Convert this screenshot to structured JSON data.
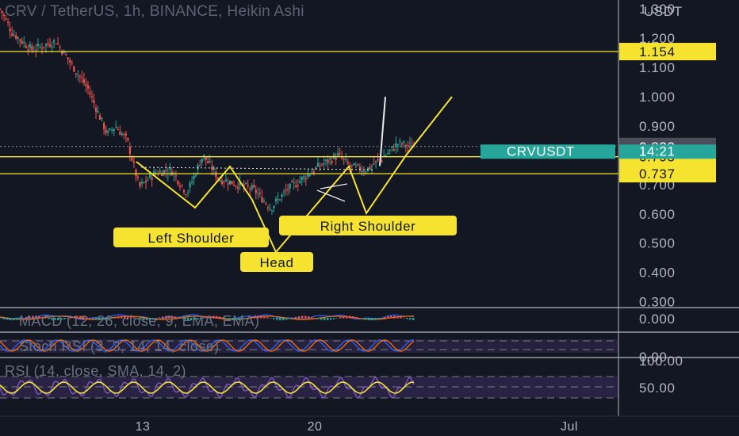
{
  "header": {
    "title": "CRV / TetherUS, 1h, BINANCE, Heikin Ashi"
  },
  "colors": {
    "background": "#131722",
    "up": "#26a69a",
    "down": "#ef5350",
    "drawing": "#f5e330",
    "rsi": "#f5e330",
    "rsi_band": "#7e57c2",
    "last_price_tag": "#26a69a",
    "text": "#b2b5be"
  },
  "price_axis": {
    "currency": "USDT",
    "ticks": [
      "1.300",
      "1.200",
      "1.100",
      "1.000",
      "0.900",
      "0.800",
      "0.700",
      "0.600",
      "0.500",
      "0.400",
      "0.300"
    ]
  },
  "time_axis": {
    "ticks": [
      "13",
      "20",
      "Jul"
    ]
  },
  "price_tags": [
    {
      "value": "1.154",
      "style": "yellow"
    },
    {
      "value": "0.830",
      "style": "gray"
    },
    {
      "value": "0.795",
      "style": "yellow"
    },
    {
      "value": "0.737",
      "style": "yellow"
    }
  ],
  "symbol_tag": {
    "symbol": "CRVUSDT",
    "countdown": "14:21"
  },
  "annotations": {
    "left_shoulder": "Left Shoulder",
    "head": "Head",
    "right_shoulder": "Right Shoulder"
  },
  "indicators": {
    "macd": {
      "label": "MACD (12, 26, close, 9, EMA, EMA)",
      "axis_value": "0.000"
    },
    "stoch": {
      "label": "Stoch RSI (3, 3, 14, 14, close)",
      "axis_value": "0.00"
    },
    "rsi": {
      "label": "RSI (14, close, SMA, 14, 2)",
      "axis_values": [
        "100.00",
        "50.00"
      ]
    }
  },
  "chart_data": {
    "type": "candlestick",
    "symbol": "CRVUSDT",
    "ylim": [
      0.28,
      1.33
    ],
    "horizontal_levels": [
      1.154,
      0.795,
      0.737
    ],
    "last_price": 0.83,
    "pattern": "Head and Shoulders",
    "price_path": [
      {
        "t": 0,
        "p": 1.3
      },
      {
        "t": 3,
        "p": 1.22
      },
      {
        "t": 8,
        "p": 1.16
      },
      {
        "t": 14,
        "p": 1.19
      },
      {
        "t": 17,
        "p": 1.13
      },
      {
        "t": 22,
        "p": 1.03
      },
      {
        "t": 27,
        "p": 0.87
      },
      {
        "t": 29,
        "p": 0.9
      },
      {
        "t": 32,
        "p": 0.85
      },
      {
        "t": 35,
        "p": 0.69
      },
      {
        "t": 39,
        "p": 0.74
      },
      {
        "t": 43,
        "p": 0.75
      },
      {
        "t": 47,
        "p": 0.67
      },
      {
        "t": 51,
        "p": 0.8
      },
      {
        "t": 55,
        "p": 0.72
      },
      {
        "t": 60,
        "p": 0.7
      },
      {
        "t": 64,
        "p": 0.68
      },
      {
        "t": 68,
        "p": 0.62
      },
      {
        "t": 72,
        "p": 0.68
      },
      {
        "t": 76,
        "p": 0.72
      },
      {
        "t": 81,
        "p": 0.77
      },
      {
        "t": 85,
        "p": 0.8
      },
      {
        "t": 88,
        "p": 0.76
      },
      {
        "t": 92,
        "p": 0.75
      },
      {
        "t": 96,
        "p": 0.79
      },
      {
        "t": 100,
        "p": 0.84
      },
      {
        "t": 104,
        "p": 0.83
      }
    ],
    "t_range": [
      0,
      104
    ]
  }
}
